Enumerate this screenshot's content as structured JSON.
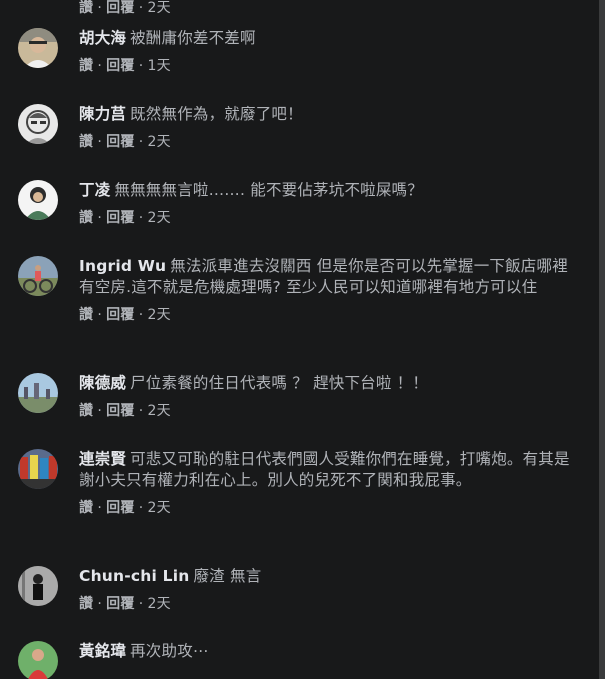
{
  "top_partial": {
    "like": "讚",
    "reply": "回覆",
    "time": "2天"
  },
  "comments": [
    {
      "author": "胡大海",
      "text": "被酬庸你差不差啊",
      "like": "讚",
      "reply": "回覆",
      "time": "1天"
    },
    {
      "author": "陳力莒",
      "text": "既然無作為，就廢了吧！",
      "like": "讚",
      "reply": "回覆",
      "time": "2天"
    },
    {
      "author": "丁凌",
      "text": "無無無無言啦……. 能不要佔茅坑不啦屎嗎？",
      "like": "讚",
      "reply": "回覆",
      "time": "2天"
    },
    {
      "author": "Ingrid Wu",
      "text": "無法派車進去沒關西 但是你是否可以先掌握一下飯店哪裡有空房.這不就是危機處理嗎? 至少人民可以知道哪裡有地方可以住",
      "like": "讚",
      "reply": "回覆",
      "time": "2天"
    },
    {
      "author": "陳德威",
      "text": "尸位素餐的住日代表嗎 ？ 趕快下台啦 ！！",
      "like": "讚",
      "reply": "回覆",
      "time": "2天"
    },
    {
      "author": "連崇賢",
      "text": "可悲又可恥的駐日代表們國人受難你們在睡覺，打嘴炮。有其是謝小夫只有權力利在心上。別人的兒死不了関和我屁事。",
      "like": "讚",
      "reply": "回覆",
      "time": "2天"
    },
    {
      "author": "Chun-chi Lin",
      "text": "廢渣 無言",
      "like": "讚",
      "reply": "回覆",
      "time": "2天"
    },
    {
      "author": "黃銘瑋",
      "text": "再次助攻⋯",
      "like": "讚",
      "reply": "回覆",
      "time": ""
    }
  ]
}
